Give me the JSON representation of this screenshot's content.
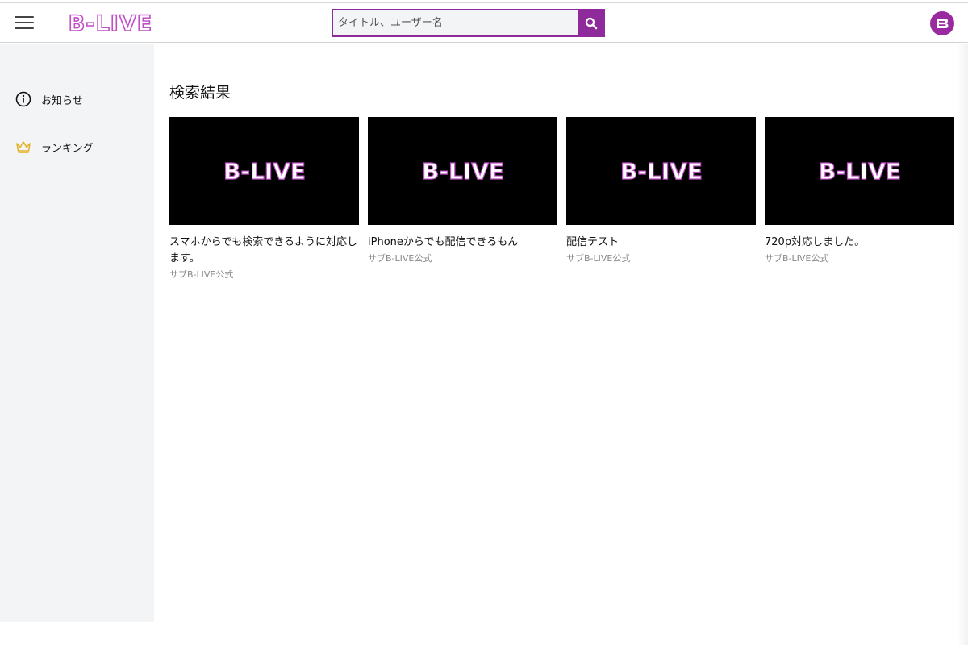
{
  "header": {
    "logo_text": "B-LIVE",
    "search_placeholder": "タイトル、ユーザー名",
    "search_value": "",
    "search_icon": "magnifier-icon",
    "menu_icon": "hamburger-icon",
    "avatar_icon": "b-logo-icon",
    "brand_color": "#8e2a9a"
  },
  "sidebar": {
    "items": [
      {
        "label": "お知らせ",
        "icon": "info-circle-icon"
      },
      {
        "label": "ランキング",
        "icon": "crown-icon",
        "icon_color": "#e3b22a"
      }
    ]
  },
  "main": {
    "title": "検索結果",
    "results": [
      {
        "title": "スマホからでも検索できるように対応します。",
        "user": "サブB-LIVE公式",
        "thumb_text": "B-LIVE"
      },
      {
        "title": "iPhoneからでも配信できるもん",
        "user": "サブB-LIVE公式",
        "thumb_text": "B-LIVE"
      },
      {
        "title": "配信テスト",
        "user": "サブB-LIVE公式",
        "thumb_text": "B-LIVE"
      },
      {
        "title": "720p対応しました。",
        "user": "サブB-LIVE公式",
        "thumb_text": "B-LIVE"
      }
    ]
  }
}
